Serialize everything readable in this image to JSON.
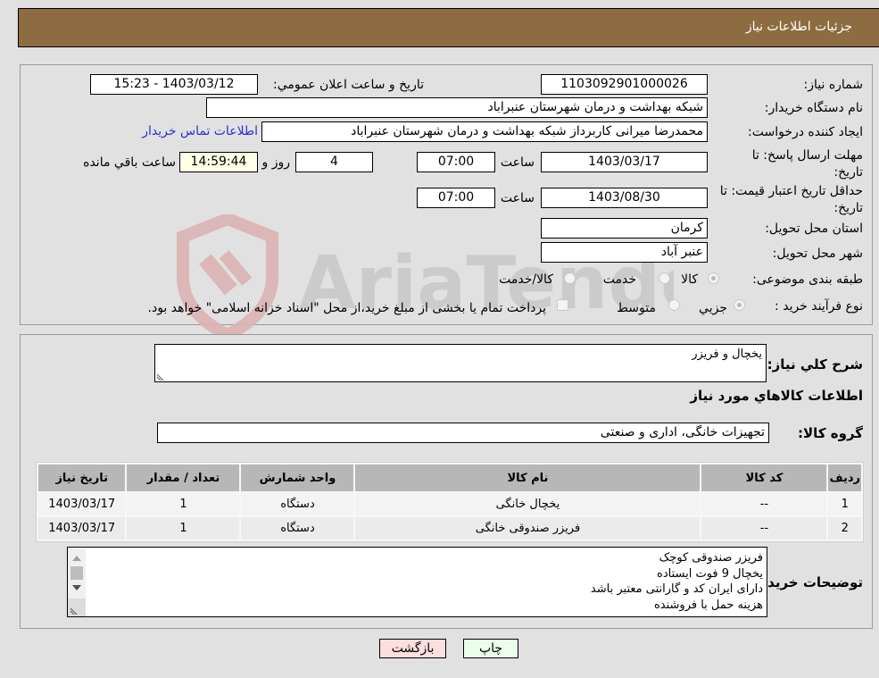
{
  "header": {
    "title": "جزئیات اطلاعات نیاز"
  },
  "details": {
    "need_number_label": "شماره نیاز:",
    "need_number": "1103092901000026",
    "announce_label": "تاریخ و ساعت اعلان عمومي:",
    "announce_value": "1403/03/12 - 15:23",
    "buyer_org_label": "نام دستگاه خریدار:",
    "buyer_org": "شبکه بهداشت و درمان شهرستان عنبراباد",
    "creator_label": "ایجاد کننده درخواست:",
    "creator": "محمدرضا میرانی کاربرداز  شبکه بهداشت و درمان شهرستان عنبراباد",
    "contact_link": "اطلاعات تماس خریدار",
    "deadline_label": "مهلت ارسال پاسخ: تا تاریخ:",
    "deadline_date": "1403/03/17",
    "time_label": "ساعت",
    "deadline_time": "07:00",
    "days_remaining": "4",
    "days_label": "روز و",
    "time_remaining": "14:59:44",
    "time_remaining_label": "ساعت باقي مانده",
    "price_validity_label": "حداقل تاریخ اعتبار قیمت: تا تاریخ:",
    "price_validity_date": "1403/08/30",
    "price_validity_time": "07:00",
    "province_label": "استان محل تحویل:",
    "province": "کرمان",
    "city_label": "شهر محل تحویل:",
    "city": "عنبر آباد",
    "category_label": "طبقه بندی موضوعی:",
    "category_options": [
      "کالا",
      "خدمت",
      "کالا/خدمت"
    ],
    "process_label": "نوع فرآیند خرید :",
    "process_options": [
      "جزيي",
      "متوسط"
    ],
    "payment_note": "پرداخت تمام یا بخشی از مبلغ خرید،از محل \"اسناد خزانه اسلامی\" خواهد بود."
  },
  "needs": {
    "summary_label": "شرح کلي نياز:",
    "summary": "یخچال و فریزر",
    "goods_info_title": "اطلاعات کالاهاي مورد نياز",
    "group_label": "گروه کالا:",
    "group": "تجهیزات خانگی، اداری و صنعتی",
    "table": {
      "headers": [
        "ردیف",
        "کد کالا",
        "نام کالا",
        "واحد شمارش",
        "تعداد / مقدار",
        "تاریخ نیاز"
      ],
      "rows": [
        [
          "1",
          "--",
          "یخچال خانگی",
          "دستگاه",
          "1",
          "1403/03/17"
        ],
        [
          "2",
          "--",
          "فریزر صندوقی خانگی",
          "دستگاه",
          "1",
          "1403/03/17"
        ]
      ]
    },
    "buyer_notes_label": "توضیحات خریدار:",
    "buyer_notes": [
      "فریزر صندوقی کوچک",
      "یخچال 9 فوت ایستاده",
      "دارای ایران کد و گارانتی معتبر باشد",
      "هزینه حمل با فروشنده"
    ]
  },
  "buttons": {
    "print": "چاپ",
    "back": "بازگشت"
  },
  "watermark": {
    "text": "AriaTender.neT"
  }
}
